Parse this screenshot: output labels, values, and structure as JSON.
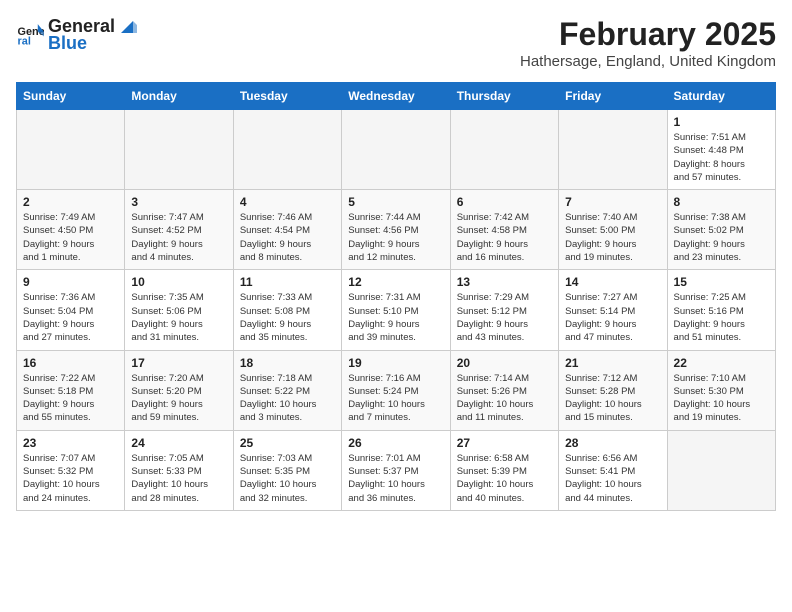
{
  "header": {
    "logo_line1": "General",
    "logo_line2": "Blue",
    "month_title": "February 2025",
    "subtitle": "Hathersage, England, United Kingdom"
  },
  "days_of_week": [
    "Sunday",
    "Monday",
    "Tuesday",
    "Wednesday",
    "Thursday",
    "Friday",
    "Saturday"
  ],
  "weeks": [
    [
      {
        "num": "",
        "info": "",
        "empty": true
      },
      {
        "num": "",
        "info": "",
        "empty": true
      },
      {
        "num": "",
        "info": "",
        "empty": true
      },
      {
        "num": "",
        "info": "",
        "empty": true
      },
      {
        "num": "",
        "info": "",
        "empty": true
      },
      {
        "num": "",
        "info": "",
        "empty": true
      },
      {
        "num": "1",
        "info": "Sunrise: 7:51 AM\nSunset: 4:48 PM\nDaylight: 8 hours\nand 57 minutes.",
        "empty": false
      }
    ],
    [
      {
        "num": "2",
        "info": "Sunrise: 7:49 AM\nSunset: 4:50 PM\nDaylight: 9 hours\nand 1 minute.",
        "empty": false
      },
      {
        "num": "3",
        "info": "Sunrise: 7:47 AM\nSunset: 4:52 PM\nDaylight: 9 hours\nand 4 minutes.",
        "empty": false
      },
      {
        "num": "4",
        "info": "Sunrise: 7:46 AM\nSunset: 4:54 PM\nDaylight: 9 hours\nand 8 minutes.",
        "empty": false
      },
      {
        "num": "5",
        "info": "Sunrise: 7:44 AM\nSunset: 4:56 PM\nDaylight: 9 hours\nand 12 minutes.",
        "empty": false
      },
      {
        "num": "6",
        "info": "Sunrise: 7:42 AM\nSunset: 4:58 PM\nDaylight: 9 hours\nand 16 minutes.",
        "empty": false
      },
      {
        "num": "7",
        "info": "Sunrise: 7:40 AM\nSunset: 5:00 PM\nDaylight: 9 hours\nand 19 minutes.",
        "empty": false
      },
      {
        "num": "8",
        "info": "Sunrise: 7:38 AM\nSunset: 5:02 PM\nDaylight: 9 hours\nand 23 minutes.",
        "empty": false
      }
    ],
    [
      {
        "num": "9",
        "info": "Sunrise: 7:36 AM\nSunset: 5:04 PM\nDaylight: 9 hours\nand 27 minutes.",
        "empty": false
      },
      {
        "num": "10",
        "info": "Sunrise: 7:35 AM\nSunset: 5:06 PM\nDaylight: 9 hours\nand 31 minutes.",
        "empty": false
      },
      {
        "num": "11",
        "info": "Sunrise: 7:33 AM\nSunset: 5:08 PM\nDaylight: 9 hours\nand 35 minutes.",
        "empty": false
      },
      {
        "num": "12",
        "info": "Sunrise: 7:31 AM\nSunset: 5:10 PM\nDaylight: 9 hours\nand 39 minutes.",
        "empty": false
      },
      {
        "num": "13",
        "info": "Sunrise: 7:29 AM\nSunset: 5:12 PM\nDaylight: 9 hours\nand 43 minutes.",
        "empty": false
      },
      {
        "num": "14",
        "info": "Sunrise: 7:27 AM\nSunset: 5:14 PM\nDaylight: 9 hours\nand 47 minutes.",
        "empty": false
      },
      {
        "num": "15",
        "info": "Sunrise: 7:25 AM\nSunset: 5:16 PM\nDaylight: 9 hours\nand 51 minutes.",
        "empty": false
      }
    ],
    [
      {
        "num": "16",
        "info": "Sunrise: 7:22 AM\nSunset: 5:18 PM\nDaylight: 9 hours\nand 55 minutes.",
        "empty": false
      },
      {
        "num": "17",
        "info": "Sunrise: 7:20 AM\nSunset: 5:20 PM\nDaylight: 9 hours\nand 59 minutes.",
        "empty": false
      },
      {
        "num": "18",
        "info": "Sunrise: 7:18 AM\nSunset: 5:22 PM\nDaylight: 10 hours\nand 3 minutes.",
        "empty": false
      },
      {
        "num": "19",
        "info": "Sunrise: 7:16 AM\nSunset: 5:24 PM\nDaylight: 10 hours\nand 7 minutes.",
        "empty": false
      },
      {
        "num": "20",
        "info": "Sunrise: 7:14 AM\nSunset: 5:26 PM\nDaylight: 10 hours\nand 11 minutes.",
        "empty": false
      },
      {
        "num": "21",
        "info": "Sunrise: 7:12 AM\nSunset: 5:28 PM\nDaylight: 10 hours\nand 15 minutes.",
        "empty": false
      },
      {
        "num": "22",
        "info": "Sunrise: 7:10 AM\nSunset: 5:30 PM\nDaylight: 10 hours\nand 19 minutes.",
        "empty": false
      }
    ],
    [
      {
        "num": "23",
        "info": "Sunrise: 7:07 AM\nSunset: 5:32 PM\nDaylight: 10 hours\nand 24 minutes.",
        "empty": false
      },
      {
        "num": "24",
        "info": "Sunrise: 7:05 AM\nSunset: 5:33 PM\nDaylight: 10 hours\nand 28 minutes.",
        "empty": false
      },
      {
        "num": "25",
        "info": "Sunrise: 7:03 AM\nSunset: 5:35 PM\nDaylight: 10 hours\nand 32 minutes.",
        "empty": false
      },
      {
        "num": "26",
        "info": "Sunrise: 7:01 AM\nSunset: 5:37 PM\nDaylight: 10 hours\nand 36 minutes.",
        "empty": false
      },
      {
        "num": "27",
        "info": "Sunrise: 6:58 AM\nSunset: 5:39 PM\nDaylight: 10 hours\nand 40 minutes.",
        "empty": false
      },
      {
        "num": "28",
        "info": "Sunrise: 6:56 AM\nSunset: 5:41 PM\nDaylight: 10 hours\nand 44 minutes.",
        "empty": false
      },
      {
        "num": "",
        "info": "",
        "empty": true
      }
    ]
  ]
}
